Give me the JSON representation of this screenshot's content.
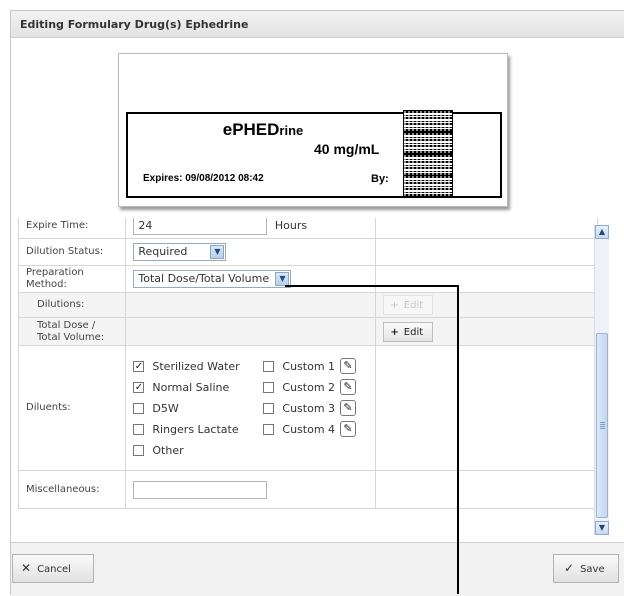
{
  "dialog": {
    "title": "Editing Formulary Drug(s) Ephedrine"
  },
  "drug_label": {
    "drug_name_upper": "ePHED",
    "drug_name_lower": "rine",
    "concentration": "40 mg/mL",
    "expires": "Expires:  09/08/2012 08:42",
    "by": "By:"
  },
  "form": {
    "expire_time": {
      "label": "Expire Time:",
      "value": "24",
      "unit": "Hours"
    },
    "dilution_status": {
      "label": "Dilution Status:",
      "value": "Required"
    },
    "preparation_method": {
      "label": "Preparation Method:",
      "value": "Total Dose/Total Volume"
    },
    "dilutions": {
      "label": "Dilutions:",
      "button": "Edit",
      "enabled": false
    },
    "total_dose_volume": {
      "label_line1": "Total Dose /",
      "label_line2": "Total Volume:",
      "button": "Edit",
      "enabled": true
    },
    "diluents": {
      "label": "Diluents:",
      "left": [
        {
          "label": "Sterilized Water",
          "checked": true
        },
        {
          "label": "Normal Saline",
          "checked": true
        },
        {
          "label": "D5W",
          "checked": false
        },
        {
          "label": "Ringers Lactate",
          "checked": false
        },
        {
          "label": "Other",
          "checked": false
        }
      ],
      "right": [
        {
          "label": "Custom 1",
          "checked": false
        },
        {
          "label": "Custom 2",
          "checked": false
        },
        {
          "label": "Custom 3",
          "checked": false
        },
        {
          "label": "Custom 4",
          "checked": false
        }
      ]
    },
    "miscellaneous": {
      "label": "Miscellaneous:",
      "value": ""
    }
  },
  "footer": {
    "cancel": "Cancel",
    "save": "Save"
  },
  "icons": {
    "plus": "+",
    "check": "✓",
    "cancel": "✕",
    "dropdown": "▼",
    "pencil": "✎",
    "scroll_up": "▲",
    "scroll_down": "▼"
  }
}
